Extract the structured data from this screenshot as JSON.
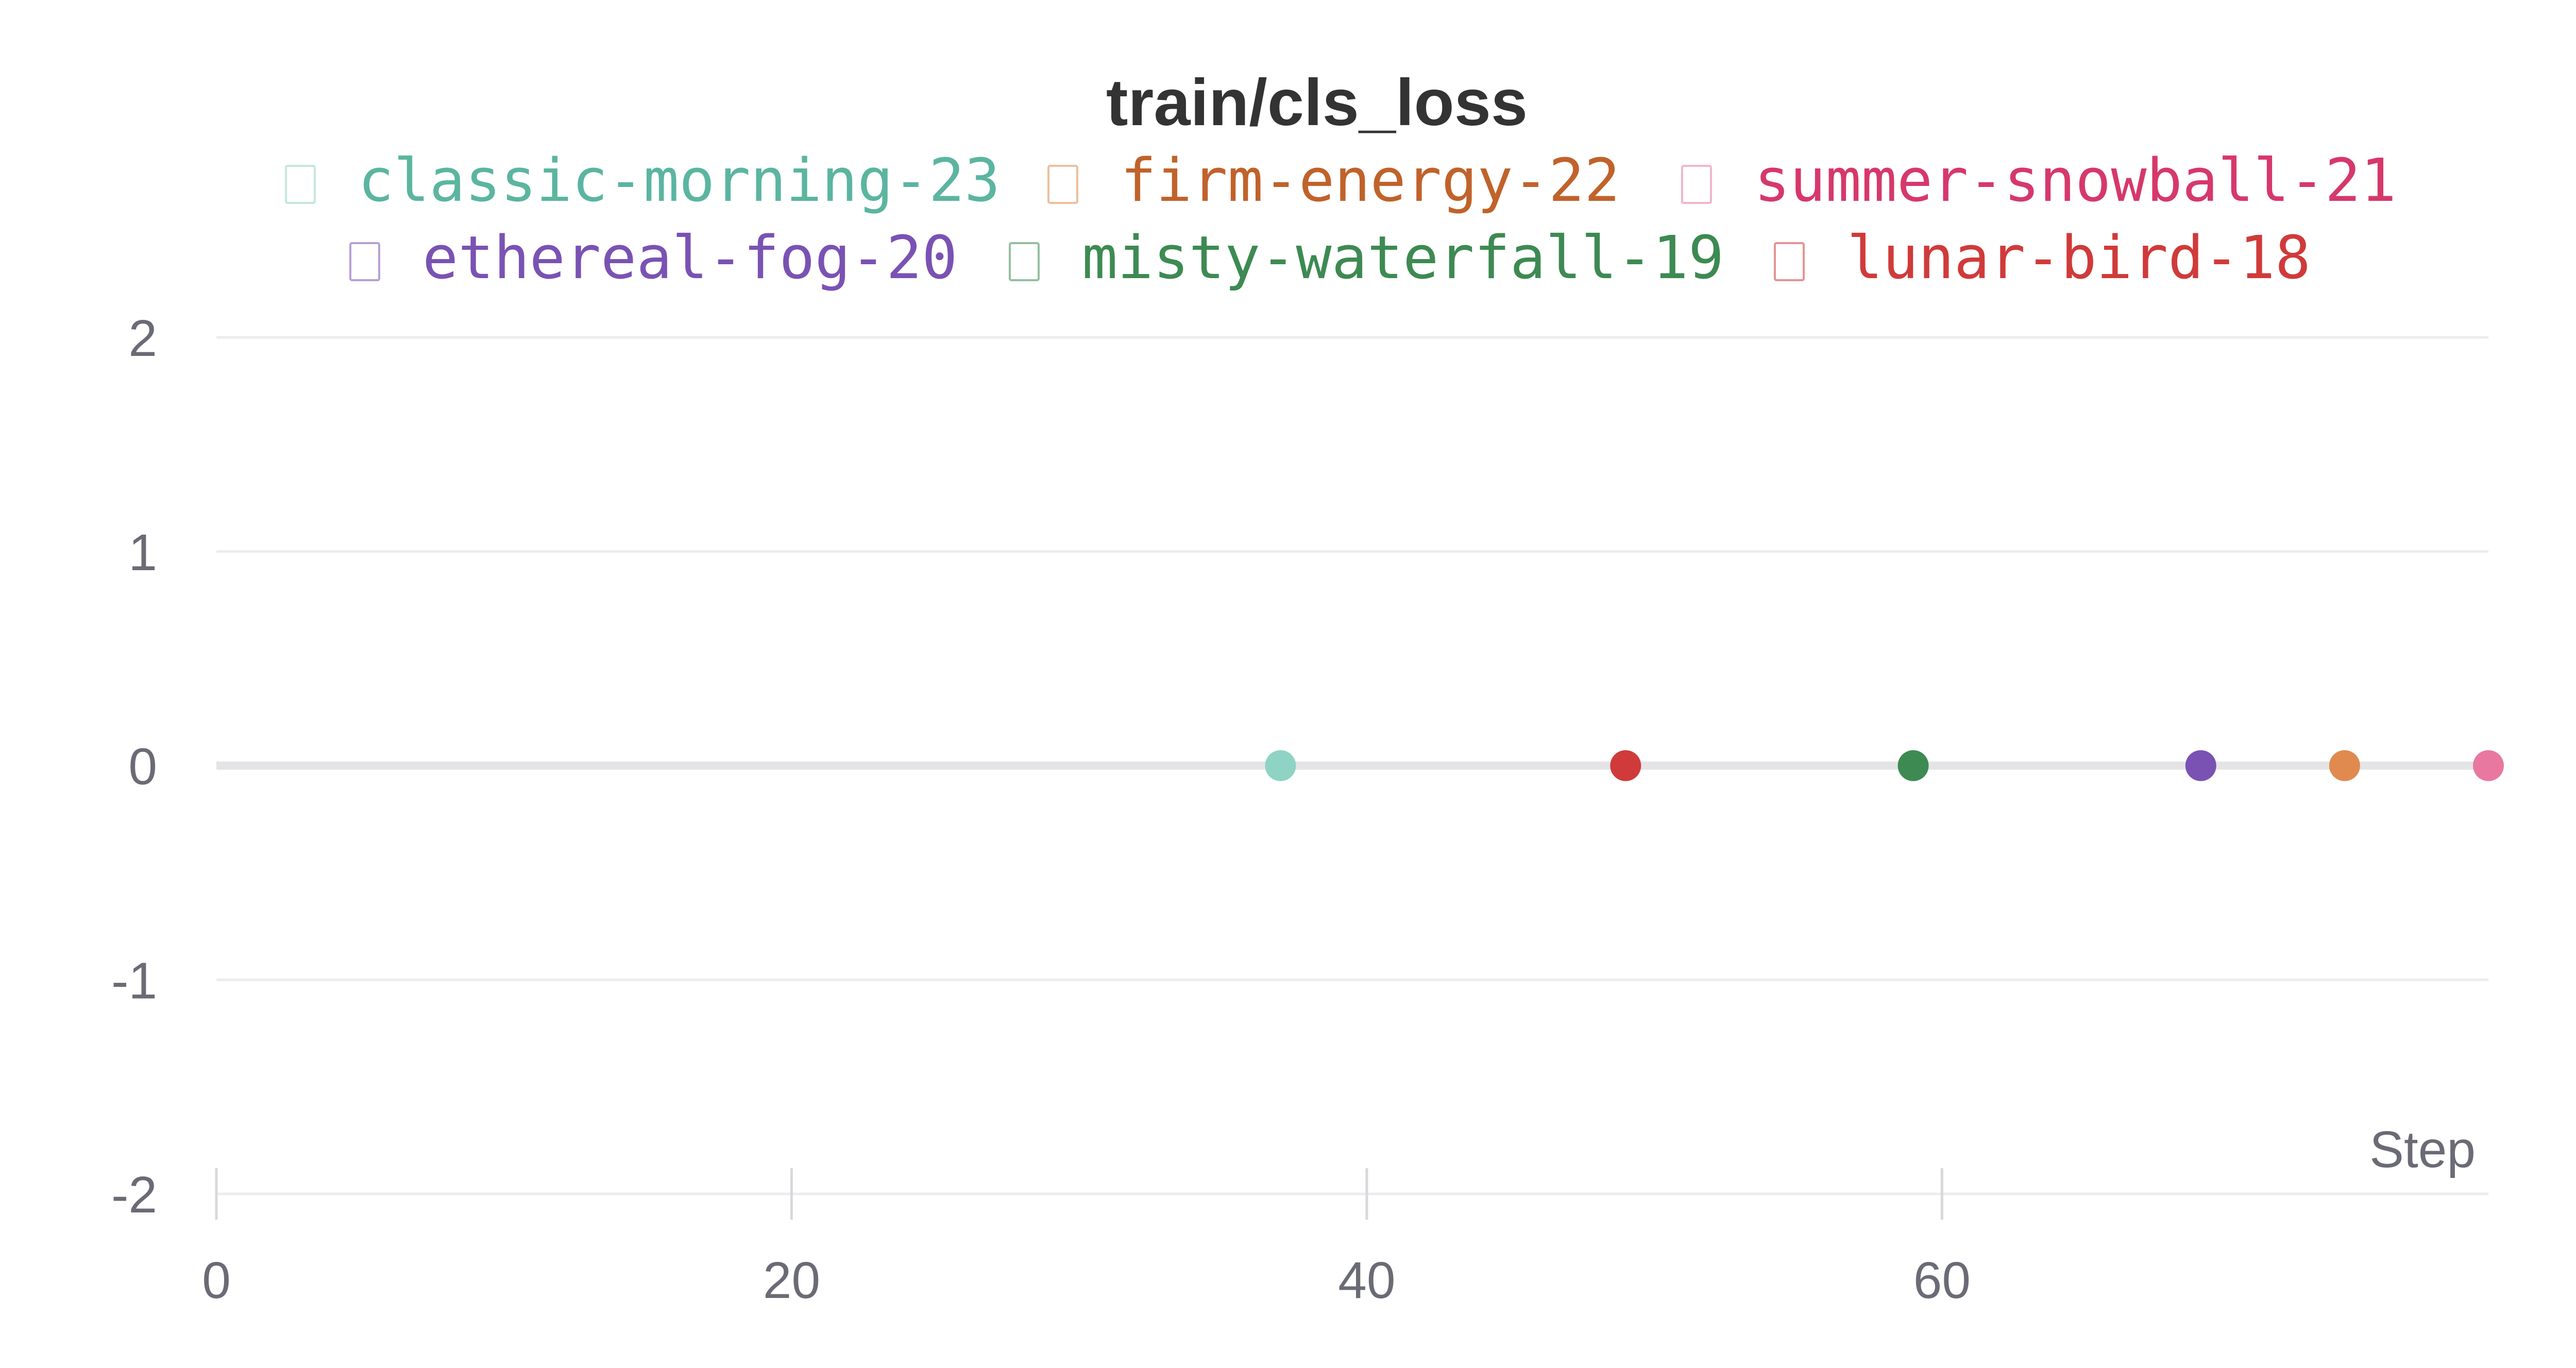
{
  "chart_data": {
    "type": "scatter",
    "title": "train/cls_loss",
    "xlabel": "Step",
    "ylabel": "",
    "xlim": [
      0,
      79
    ],
    "ylim": [
      -2,
      2
    ],
    "x_ticks": [
      "0",
      "20",
      "40",
      "60"
    ],
    "y_ticks": [
      "2",
      "1",
      "0",
      "-1",
      "-2"
    ],
    "grid": true,
    "legend_position": "top",
    "series": [
      {
        "name": "classic-morning-23",
        "color": "#5bb5a0",
        "marker_color": "#8fd3c4",
        "x": [
          37
        ],
        "y": [
          0
        ]
      },
      {
        "name": "firm-energy-22",
        "color": "#c0622a",
        "marker_color": "#e08a50",
        "x": [
          74
        ],
        "y": [
          0
        ]
      },
      {
        "name": "summer-snowball-21",
        "color": "#d6386b",
        "marker_color": "#e8789f",
        "x": [
          79
        ],
        "y": [
          0
        ]
      },
      {
        "name": "ethereal-fog-20",
        "color": "#7a52b3",
        "marker_color": "#7a52b3",
        "x": [
          69
        ],
        "y": [
          0
        ]
      },
      {
        "name": "misty-waterfall-19",
        "color": "#3d8a52",
        "marker_color": "#3d8a52",
        "x": [
          59
        ],
        "y": [
          0
        ]
      },
      {
        "name": "lunar-bird-18",
        "color": "#d03a3a",
        "marker_color": "#d03a3a",
        "x": [
          49
        ],
        "y": [
          0
        ]
      }
    ]
  }
}
